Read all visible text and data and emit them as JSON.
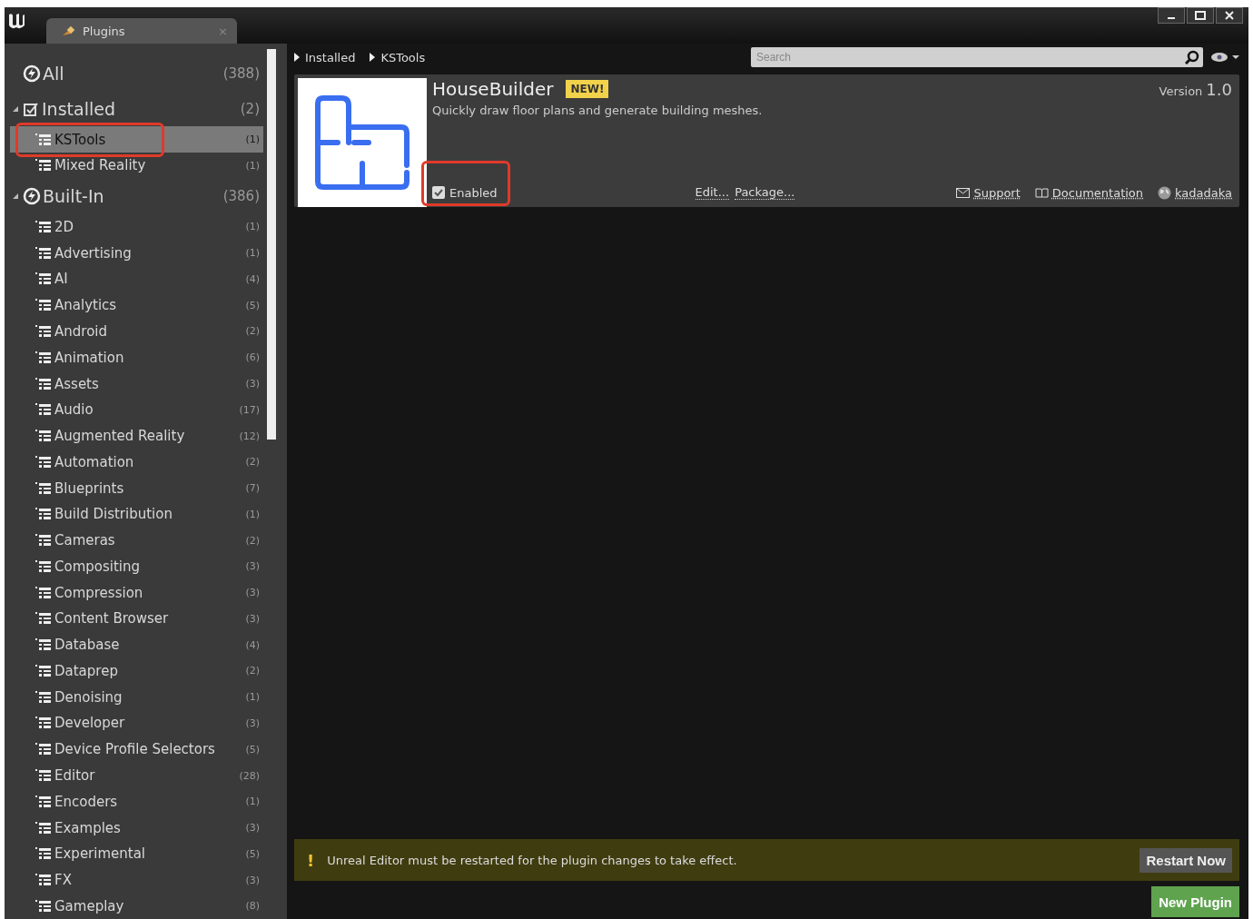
{
  "window": {
    "tab": {
      "title": "Plugins",
      "close": "×"
    }
  },
  "sidebar": {
    "items": [
      {
        "kind": "root",
        "label": "All",
        "count": "(388)",
        "selected": false
      },
      {
        "kind": "group",
        "label": "Installed",
        "count": "(2)",
        "expanded": true,
        "children": [
          {
            "label": "KSTools",
            "count": "(1)",
            "selected": true
          },
          {
            "label": "Mixed Reality",
            "count": "(1)",
            "selected": false
          }
        ]
      },
      {
        "kind": "group",
        "label": "Built-In",
        "count": "(386)",
        "expanded": true,
        "children": [
          {
            "label": "2D",
            "count": "(1)",
            "selected": false
          },
          {
            "label": "Advertising",
            "count": "(1)",
            "selected": false
          },
          {
            "label": "AI",
            "count": "(4)",
            "selected": false
          },
          {
            "label": "Analytics",
            "count": "(5)",
            "selected": false
          },
          {
            "label": "Android",
            "count": "(2)",
            "selected": false
          },
          {
            "label": "Animation",
            "count": "(6)",
            "selected": false
          },
          {
            "label": "Assets",
            "count": "(3)",
            "selected": false
          },
          {
            "label": "Audio",
            "count": "(17)",
            "selected": false
          },
          {
            "label": "Augmented Reality",
            "count": "(12)",
            "selected": false
          },
          {
            "label": "Automation",
            "count": "(2)",
            "selected": false
          },
          {
            "label": "Blueprints",
            "count": "(7)",
            "selected": false
          },
          {
            "label": "Build Distribution",
            "count": "(1)",
            "selected": false
          },
          {
            "label": "Cameras",
            "count": "(2)",
            "selected": false
          },
          {
            "label": "Compositing",
            "count": "(3)",
            "selected": false
          },
          {
            "label": "Compression",
            "count": "(3)",
            "selected": false
          },
          {
            "label": "Content Browser",
            "count": "(3)",
            "selected": false
          },
          {
            "label": "Database",
            "count": "(4)",
            "selected": false
          },
          {
            "label": "Dataprep",
            "count": "(2)",
            "selected": false
          },
          {
            "label": "Denoising",
            "count": "(1)",
            "selected": false
          },
          {
            "label": "Developer",
            "count": "(3)",
            "selected": false
          },
          {
            "label": "Device Profile Selectors",
            "count": "(5)",
            "selected": false
          },
          {
            "label": "Editor",
            "count": "(28)",
            "selected": false
          },
          {
            "label": "Encoders",
            "count": "(1)",
            "selected": false
          },
          {
            "label": "Examples",
            "count": "(3)",
            "selected": false
          },
          {
            "label": "Experimental",
            "count": "(5)",
            "selected": false
          },
          {
            "label": "FX",
            "count": "(3)",
            "selected": false
          },
          {
            "label": "Gameplay",
            "count": "(8)",
            "selected": false
          }
        ]
      }
    ]
  },
  "breadcrumb": [
    "Installed",
    "KSTools"
  ],
  "search": {
    "placeholder": "Search"
  },
  "plugin": {
    "name": "HouseBuilder",
    "badge": "NEW!",
    "description": "Quickly draw floor plans and generate building meshes.",
    "version_label": "Version",
    "version": "1.0",
    "enabled": {
      "label": "Enabled",
      "checked": true
    },
    "actions": [
      "Edit...",
      "Package..."
    ],
    "links": [
      {
        "kind": "mail",
        "label": "Support"
      },
      {
        "kind": "book",
        "label": "Documentation"
      },
      {
        "kind": "globe",
        "label": "kadadaka"
      }
    ]
  },
  "notice": {
    "icon": "!",
    "message": "Unreal Editor must be restarted for the plugin changes to take effect.",
    "button": "Restart Now"
  },
  "new_plugin_button": "New Plugin"
}
